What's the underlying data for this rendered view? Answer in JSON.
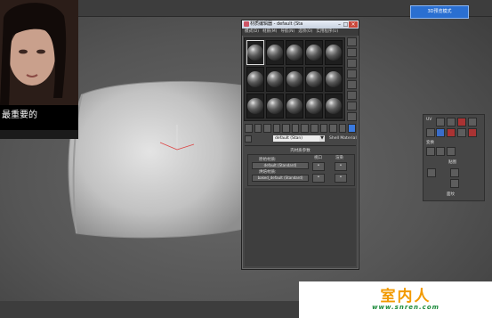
{
  "top_right_button": "3D预览模式",
  "video": {
    "caption": "最重要的"
  },
  "material_editor": {
    "title": "材质编辑器 - default (Sta",
    "close_glyph": "×",
    "menu": [
      "模式(D)",
      "材质(M)",
      "导航(N)",
      "选项(O)",
      "实用程序(U)"
    ],
    "name_value": "default (Stan)",
    "name_dropdown": "▼",
    "standard_label": "Shell Material",
    "panel_title": "壳材质参数",
    "original_material_label": "原始材质:",
    "original_material_value": "default (Standard)",
    "baked_material_label": "烘焙材质:",
    "baked_material_value": "baked_default (Standard)",
    "viewport_label": "视口",
    "render_label": "渲染",
    "slot_count": 15,
    "selected_slot": 0
  },
  "command_panel": {
    "labels": [
      "UV",
      "变换",
      "贴图",
      "面纹"
    ]
  }
}
